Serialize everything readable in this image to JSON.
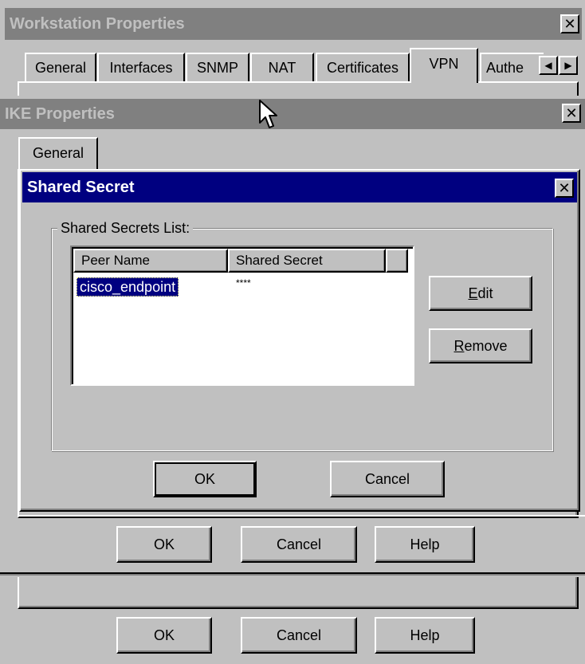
{
  "workstation": {
    "title": "Workstation Properties",
    "close_icon": "close-icon",
    "tabs": [
      {
        "label": "General"
      },
      {
        "label": "Interfaces"
      },
      {
        "label": "SNMP"
      },
      {
        "label": "NAT"
      },
      {
        "label": "Certificates"
      },
      {
        "label": "VPN"
      },
      {
        "label": "Authe"
      }
    ],
    "active_tab": "VPN",
    "buttons": {
      "ok": "OK",
      "cancel": "Cancel",
      "help": "Help"
    }
  },
  "ike": {
    "title": "IKE Properties",
    "tabs": [
      {
        "label": "General"
      }
    ],
    "buttons": {
      "ok": "OK",
      "cancel": "Cancel",
      "help": "Help"
    }
  },
  "shared_secret": {
    "title": "Shared Secret",
    "group_label": "Shared Secrets List:",
    "columns": [
      "Peer Name",
      "Shared Secret"
    ],
    "rows": [
      {
        "peer_name": "cisco_endpoint",
        "secret": "****"
      }
    ],
    "edit_prefix": "E",
    "edit_rest": "dit",
    "remove_prefix": "R",
    "remove_rest": "emove",
    "ok": "OK",
    "cancel": "Cancel"
  },
  "colors": {
    "active_title": "#000080",
    "inactive_title": "#808080",
    "face": "#c0c0c0",
    "selection": "#000080"
  }
}
